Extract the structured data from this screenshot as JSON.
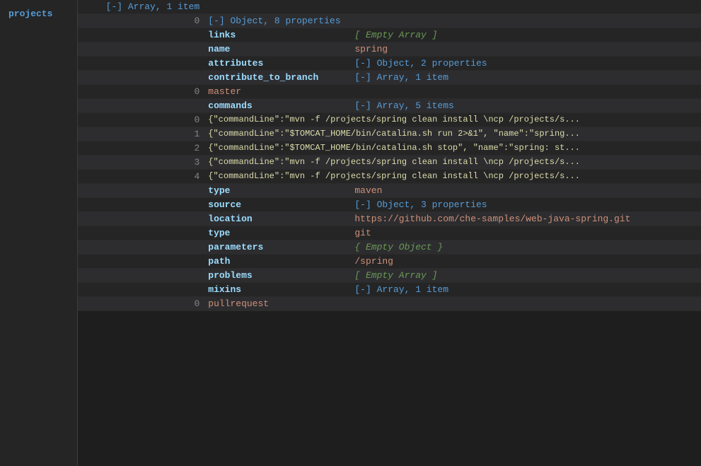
{
  "sidebar": {
    "items": [
      {
        "label": "projects"
      }
    ]
  },
  "tree": {
    "root_label": "[-] Array, 1 item",
    "root_index": "0",
    "root_meta": "[-] Object, 8 properties",
    "rows": {
      "links": {
        "key": "links",
        "value": "[ Empty Array ]"
      },
      "name": {
        "key": "name",
        "value": "spring"
      },
      "attributes": {
        "key": "attributes",
        "meta": "[-] Object, 2 properties"
      },
      "contribute_to_branch": {
        "key": "contribute_to_branch",
        "meta": "[-] Array, 1 item",
        "index": "0",
        "value": "master"
      },
      "commands": {
        "key": "commands",
        "meta": "[-] Array, 5 items",
        "items": [
          {
            "index": "0",
            "value": "{\"commandLine\":\"mvn -f /projects/spring clean install \\ncp /projects/s..."
          },
          {
            "index": "1",
            "value": "{\"commandLine\":\"$TOMCAT_HOME/bin/catalina.sh run 2>&1\", \"name\":\"spring..."
          },
          {
            "index": "2",
            "value": "{\"commandLine\":\"$TOMCAT_HOME/bin/catalina.sh stop\", \"name\":\"spring: st..."
          },
          {
            "index": "3",
            "value": "{\"commandLine\":\"mvn -f /projects/spring clean install \\ncp /projects/s..."
          },
          {
            "index": "4",
            "value": "{\"commandLine\":\"mvn -f /projects/spring clean install \\ncp /projects/s..."
          }
        ]
      },
      "type": {
        "key": "type",
        "value": "maven"
      },
      "source": {
        "key": "source",
        "meta": "[-] Object, 3 properties",
        "location": {
          "key": "location",
          "value": "https://github.com/che-samples/web-java-spring.git"
        },
        "type": {
          "key": "type",
          "value": "git"
        },
        "parameters": {
          "key": "parameters",
          "value": "{ Empty Object }"
        }
      },
      "path": {
        "key": "path",
        "value": "/spring"
      },
      "problems": {
        "key": "problems",
        "value": "[ Empty Array ]"
      },
      "mixins": {
        "key": "mixins",
        "meta": "[-] Array, 1 item",
        "index": "0",
        "value": "pullrequest"
      }
    }
  }
}
